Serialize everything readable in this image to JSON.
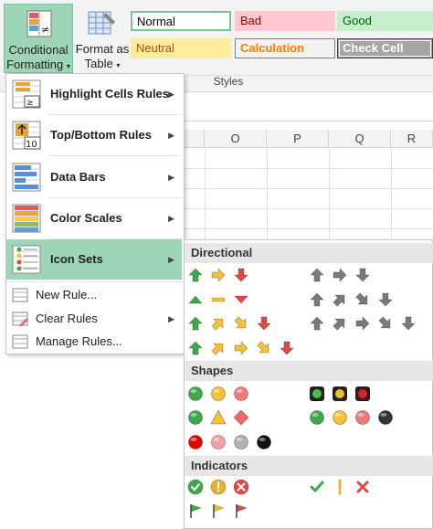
{
  "ribbon": {
    "conditional_formatting_line1": "Conditional",
    "conditional_formatting_line2": "Formatting",
    "format_as_table_line1": "Format as",
    "format_as_table_line2": "Table",
    "styles_group_label": "Styles",
    "cell_styles": [
      {
        "label": "Normal",
        "bg": "#ffffff",
        "fg": "#000000",
        "border": "#7fbf99"
      },
      {
        "label": "Bad",
        "bg": "#ffc7ce",
        "fg": "#9c0006",
        "border": "#ffc7ce"
      },
      {
        "label": "Good",
        "bg": "#c6efce",
        "fg": "#006100",
        "border": "#c6efce"
      },
      {
        "label": "Neutral",
        "bg": "#ffeb9c",
        "fg": "#9c5700",
        "border": "#ffeb9c"
      },
      {
        "label": "Calculation",
        "bg": "#f2f2f2",
        "fg": "#fa7d00",
        "border": "#7f7f7f"
      },
      {
        "label": "Check Cell",
        "bg": "#a5a5a5",
        "fg": "#ffffff",
        "border": "#3f3f3f"
      }
    ]
  },
  "columns": [
    "O",
    "P",
    "Q",
    "R"
  ],
  "menu": {
    "items": [
      {
        "label": "Highlight Cells Rules"
      },
      {
        "label": "Top/Bottom Rules"
      },
      {
        "label": "Data Bars"
      },
      {
        "label": "Color Scales"
      },
      {
        "label": "Icon Sets"
      }
    ],
    "secondary": [
      {
        "label": "New Rule..."
      },
      {
        "label": "Clear Rules"
      },
      {
        "label": "Manage Rules..."
      }
    ],
    "top_bottom_icon_text": "10"
  },
  "submenu": {
    "sections": [
      "Directional",
      "Shapes",
      "Indicators"
    ]
  },
  "colors": {
    "accent": "#9fd5b7",
    "green": "#3ea94b",
    "yellow": "#f5c136",
    "red": "#e04848",
    "gray": "#7a7a7a"
  }
}
